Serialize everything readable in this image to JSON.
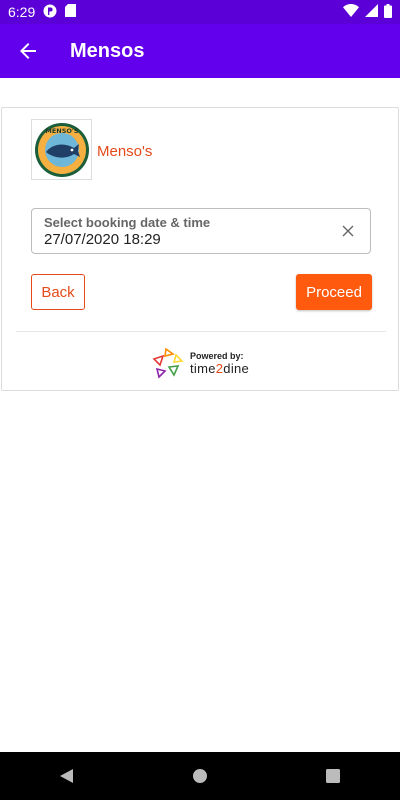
{
  "status_bar": {
    "time": "6:29",
    "icons": [
      "notification-icon",
      "sd-card-icon",
      "wifi-icon",
      "signal-icon",
      "battery-icon"
    ]
  },
  "app_bar": {
    "title": "Mensos",
    "back_icon": "arrow-back-icon",
    "color": "#6200ee"
  },
  "restaurant": {
    "name": "Menso's",
    "logo_text": "MENSO'S",
    "logo_subtext": "FISHING & PASTAS"
  },
  "booking_field": {
    "label": "Select booking date & time",
    "value": "27/07/2020 18:29",
    "clear_icon": "close-icon"
  },
  "buttons": {
    "back_label": "Back",
    "proceed_label": "Proceed"
  },
  "footer": {
    "powered_label": "Powered by:",
    "brand_prefix": "time",
    "brand_accent": "2",
    "brand_suffix": "dine"
  },
  "colors": {
    "accent": "#e64a19",
    "proceed": "#ff5a0d",
    "app_bar": "#6200ee"
  },
  "nav_bar": {
    "icons": [
      "back-triangle-icon",
      "home-circle-icon",
      "recents-square-icon"
    ]
  }
}
